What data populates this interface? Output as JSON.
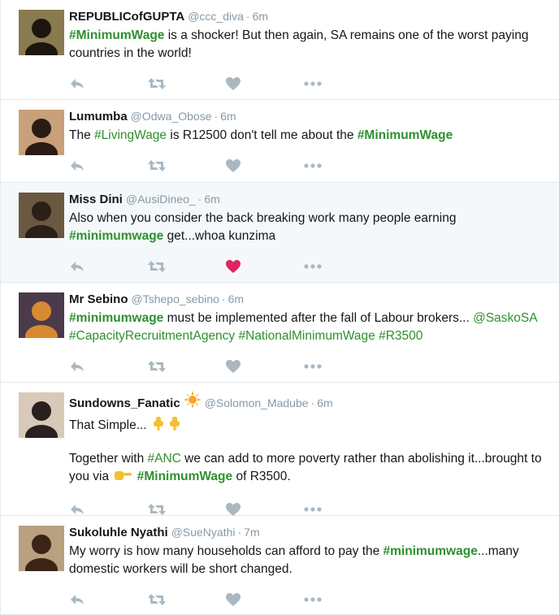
{
  "colors": {
    "hashtag": "#2f8f2f",
    "meta": "#8899a6",
    "action_icon": "#aab8c2",
    "liked_heart": "#e0245e",
    "highlight_bg": "#f5f8fa"
  },
  "tweets": [
    {
      "name": "REPUBLICofGUPTA",
      "handle": "@ccc_diva",
      "sep": "·",
      "time": "6m",
      "highlighted": false,
      "liked": false,
      "lines": [
        [
          {
            "t": "#MinimumWage",
            "tag": true,
            "bold": true
          },
          {
            "t": " is a shocker! But then again, SA remains one of the worst paying countries in the world!"
          }
        ]
      ]
    },
    {
      "name": "Lumumba",
      "handle": "@Odwa_Obose",
      "sep": "·",
      "time": "6m",
      "highlighted": false,
      "liked": false,
      "lines": [
        [
          {
            "t": "The "
          },
          {
            "t": "#LivingWage",
            "tag": true
          },
          {
            "t": " is R12500 don't tell me about the "
          },
          {
            "t": "#MinimumWage",
            "tag": true,
            "bold": true
          }
        ]
      ]
    },
    {
      "name": "Miss Dini",
      "handle": "@AusiDineo_",
      "sep": "·",
      "time": "6m",
      "highlighted": true,
      "liked": true,
      "lines": [
        [
          {
            "t": "Also when you consider the back breaking work many people earning "
          },
          {
            "t": "#minimumwage",
            "tag": true,
            "bold": true
          },
          {
            "t": " get...whoa kunzima"
          }
        ]
      ]
    },
    {
      "name": "Mr Sebino",
      "handle": "@Tshepo_sebino",
      "sep": "·",
      "time": "6m",
      "highlighted": false,
      "liked": false,
      "lines": [
        [
          {
            "t": "#minimumwage",
            "tag": true,
            "bold": true
          },
          {
            "t": " must be implemented after the fall of Labour brokers... "
          },
          {
            "t": "@SaskoSA",
            "tag": true
          },
          {
            "t": " "
          },
          {
            "t": "#CapacityRecruitmentAgency",
            "tag": true
          },
          {
            "t": " "
          },
          {
            "t": "#NationalMinimumWage",
            "tag": true
          },
          {
            "t": " "
          },
          {
            "t": "#R3500",
            "tag": true
          }
        ]
      ]
    },
    {
      "name": "Sundowns_Fanatic",
      "handle": "@Solomon_Madube",
      "sep": "·",
      "time": "6m",
      "highlighted": false,
      "liked": false,
      "badge": "sun-emoji",
      "lines": [
        [
          {
            "t": "That Simple... "
          },
          {
            "emoji": "point-down-emoji"
          },
          {
            "emoji": "point-down-emoji"
          }
        ],
        [
          {
            "t": "Together with "
          },
          {
            "t": "#ANC",
            "tag": true
          },
          {
            "t": " we can add to more poverty rather than abolishing it...brought to you via "
          },
          {
            "emoji": "point-right-emoji"
          },
          {
            "t": " "
          },
          {
            "t": "#MinimumWage",
            "tag": true,
            "bold": true
          },
          {
            "t": " of R3500."
          }
        ]
      ]
    },
    {
      "name": "Sukoluhle Nyathi",
      "handle": "@SueNyathi",
      "sep": "·",
      "time": "7m",
      "highlighted": false,
      "liked": false,
      "lines": [
        [
          {
            "t": "My worry is how many households can afford to pay the "
          },
          {
            "t": "#minimumwage",
            "tag": true,
            "bold": true
          },
          {
            "t": "...many domestic workers will be short changed."
          }
        ]
      ]
    }
  ],
  "action_icons": [
    "reply-icon",
    "retweet-icon",
    "like-icon",
    "more-icon"
  ]
}
